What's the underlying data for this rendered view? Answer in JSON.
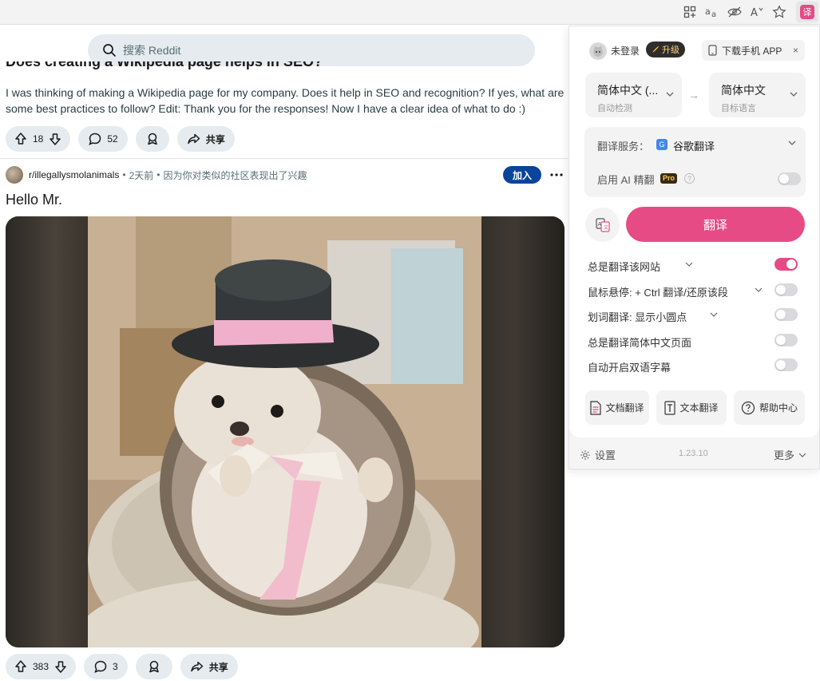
{
  "browser": {
    "toolbar_icons": [
      "apps-icon",
      "read-aloud-icon",
      "tracking-prevention-icon",
      "text-size-icon",
      "favorite-star-icon",
      "translate-extension-icon"
    ],
    "ext_glyph": "译"
  },
  "reddit": {
    "search": {
      "placeholder": "搜索 Reddit"
    },
    "prev_post": {
      "title": "Does creating a Wikipedia page helps in SEO?",
      "body": "I was thinking of making a Wikipedia page for my company. Does it help in SEO and recognition? If yes, what are some best practices to follow? Edit: Thank you for the responses! Now I have a clear idea of what to do :)",
      "upvotes": "18",
      "comments": "52",
      "share_label": "共享"
    },
    "post": {
      "subreddit": "r/illegallysmolanimals",
      "separator": "•",
      "time": "2天前",
      "reason": "因为你对类似的社区表现出了兴趣",
      "join_label": "加入",
      "more_label": "•••",
      "title": "Hello Mr.",
      "upvotes": "383",
      "comments": "3",
      "share_label": "共享"
    }
  },
  "popup": {
    "login_status": "未登录",
    "upgrade_label": "升级",
    "download_label": "下载手机 APP",
    "close_glyph": "×",
    "source_lang": {
      "name": "简体中文 (...",
      "hint": "自动检测"
    },
    "swap_glyph": "→",
    "target_lang": {
      "name": "简体中文",
      "hint": "目标语言"
    },
    "service_label": "翻译服务：",
    "service_icon_glyph": "G",
    "service_name": "谷歌翻译",
    "ai_label": "启用 AI 精翻",
    "pro_badge": "Pro",
    "help_glyph": "?",
    "ai_enabled": false,
    "translate_button": "翻译",
    "options": [
      {
        "label": "总是翻译该网站",
        "on": true
      },
      {
        "label": "鼠标悬停:  + Ctrl 翻译/还原该段",
        "on": false
      },
      {
        "label": "划词翻译:  显示小圆点",
        "on": false
      },
      {
        "label": "总是翻译简体中文页面",
        "on": false
      },
      {
        "label": "自动开启双语字幕",
        "on": false
      }
    ],
    "tools": {
      "doc": "文档翻译",
      "text": "文本翻译",
      "help": "帮助中心"
    },
    "footer": {
      "settings": "设置",
      "version": "1.23.10",
      "more": "更多"
    },
    "accent_color": "#e64b86"
  }
}
